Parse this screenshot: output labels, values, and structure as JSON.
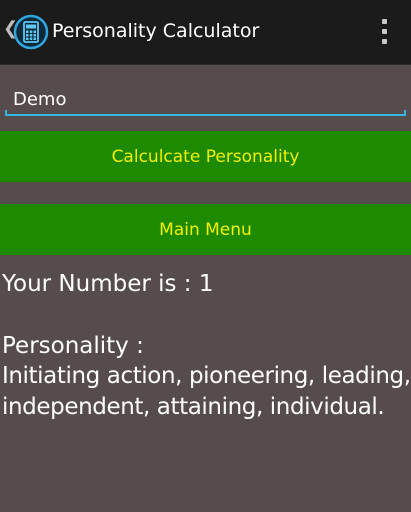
{
  "action_bar": {
    "title": "Personality Calculator",
    "up_icon": "chevron-left-icon",
    "app_icon": "calculator-icon",
    "overflow_icon": "more-vertical-icon"
  },
  "form": {
    "name_value": "Demo",
    "calculate_label": "Calculcate Personality",
    "main_menu_label": "Main Menu"
  },
  "result": {
    "number_text": "Your Number is : 1",
    "personality_heading": "Personality :",
    "personality_text": "Initiating action, pioneering, leading, independent, attaining, individual."
  },
  "colors": {
    "background": "#564c4b",
    "action_bar": "#1b1b1b",
    "button_bg": "#1e8a00",
    "button_text": "#f0f000",
    "accent": "#33b5e5"
  }
}
